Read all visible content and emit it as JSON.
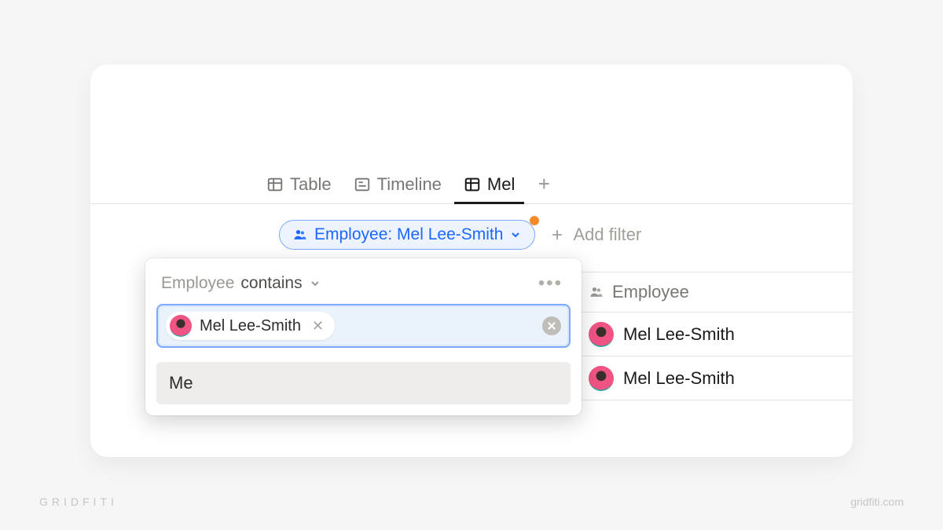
{
  "views": {
    "tabs": [
      {
        "label": "Table",
        "icon": "table-icon",
        "active": false
      },
      {
        "label": "Timeline",
        "icon": "timeline-icon",
        "active": false
      },
      {
        "label": "Mel",
        "icon": "table-icon",
        "active": true
      }
    ]
  },
  "filter": {
    "pill_label": "Employee: Mel Lee-Smith",
    "add_filter_label": "Add filter"
  },
  "column": {
    "header": "Employee"
  },
  "rows": [
    {
      "name": "Mel Lee-Smith"
    },
    {
      "name": "Mel Lee-Smith"
    }
  ],
  "popover": {
    "field_name": "Employee",
    "operator": "contains",
    "token_name": "Mel Lee-Smith",
    "option_me": "Me"
  },
  "watermark": {
    "brand": "GRIDFITI",
    "url": "gridfiti.com"
  }
}
